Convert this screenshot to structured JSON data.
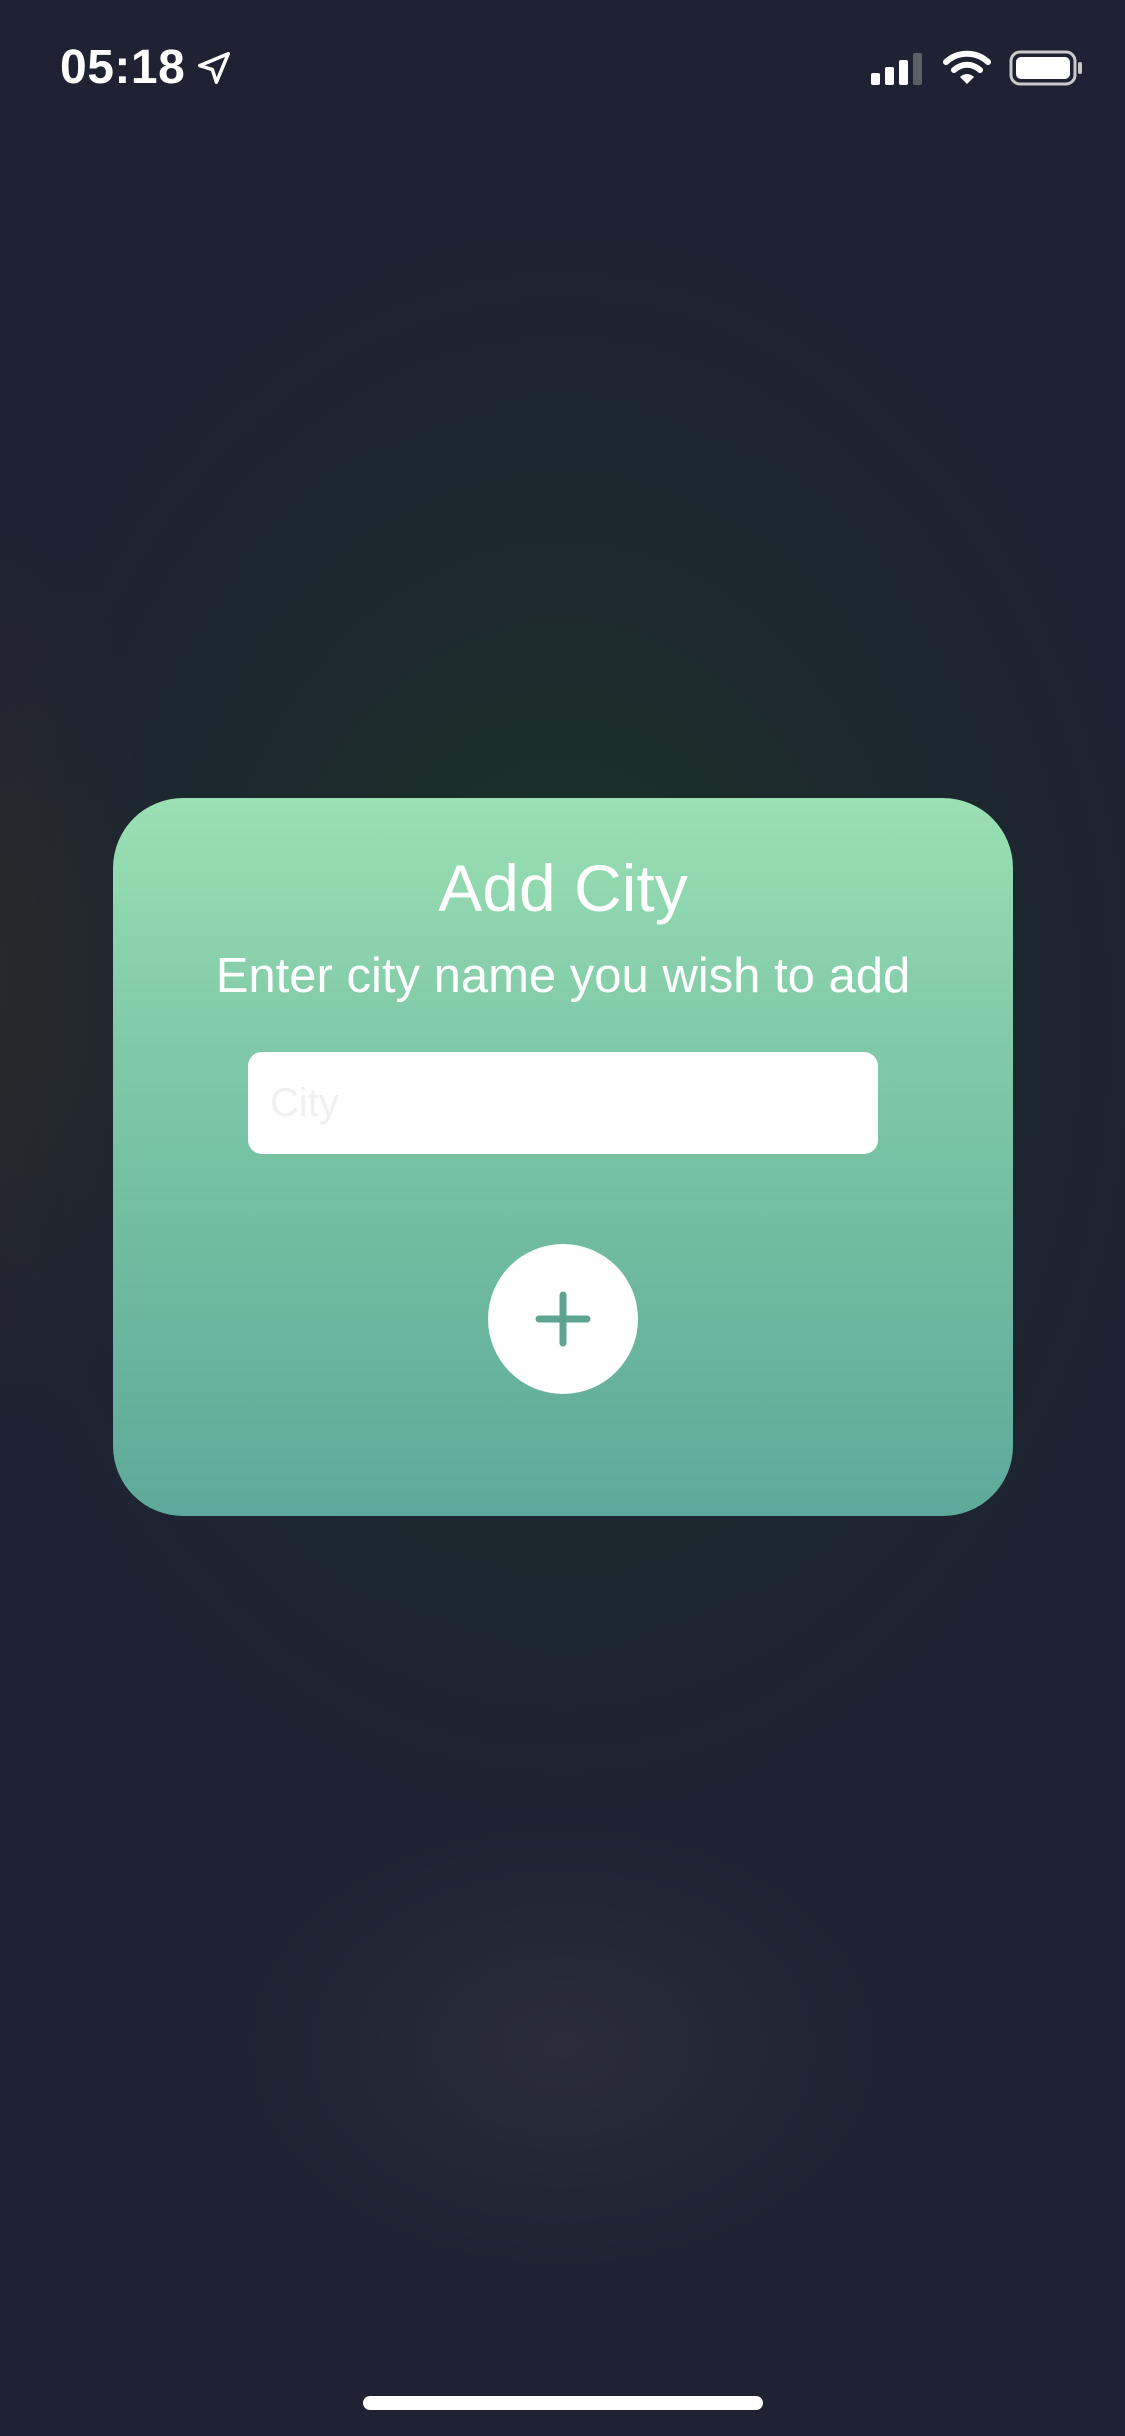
{
  "status_bar": {
    "time": "05:18",
    "location_icon": "location-arrow-icon",
    "signal_icon": "cellular-signal-icon",
    "wifi_icon": "wifi-icon",
    "battery_icon": "battery-icon"
  },
  "add_city_card": {
    "title": "Add City",
    "subtitle": "Enter city name you wish to add",
    "city_input": {
      "value": "",
      "placeholder": "City"
    },
    "add_button_icon": "plus-icon"
  },
  "colors": {
    "background": "#1e2232",
    "card_gradient_top": "#9ae0b3",
    "card_gradient_bottom": "#5ea99b",
    "accent": "#5da591",
    "text": "#ffffff"
  }
}
